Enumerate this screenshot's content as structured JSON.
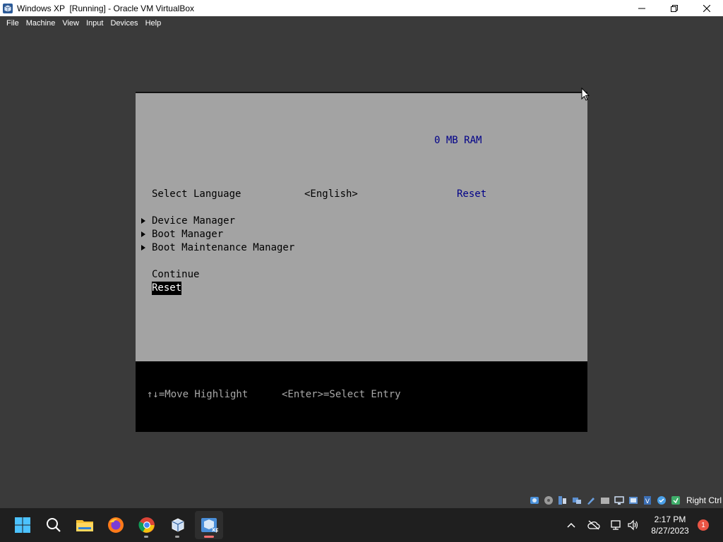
{
  "window": {
    "title": "Windows XP  [Running] - Oracle VM VirtualBox",
    "controls": [
      "minimize",
      "maximize",
      "close"
    ]
  },
  "menubar": {
    "items": [
      "File",
      "Machine",
      "View",
      "Input",
      "Devices",
      "Help"
    ]
  },
  "vm": {
    "ram": "0 MB RAM",
    "language": {
      "label": "Select Language",
      "value": "<English>",
      "reset": "Reset"
    },
    "menu": [
      {
        "label": "Device Manager",
        "submenu": true
      },
      {
        "label": "Boot Manager",
        "submenu": true
      },
      {
        "label": "Boot Maintenance Manager",
        "submenu": true
      }
    ],
    "actions": [
      {
        "label": "Continue",
        "selected": false
      },
      {
        "label": "Reset",
        "selected": true
      }
    ],
    "footer": {
      "help_move": "↑↓=Move Highlight",
      "help_select": "<Enter>=Select Entry"
    }
  },
  "statusbar": {
    "icons": [
      "hard-disk-icon",
      "optical-drive-icon",
      "audio-icon",
      "network-icon",
      "usb-icon",
      "shared-folder-icon",
      "display-icon",
      "video-capture-icon",
      "cpu-icon",
      "guest-additions-icon",
      "mouse-integration-icon"
    ],
    "host_key": "Right Ctrl"
  },
  "taskbar": {
    "apps": [
      "start-icon",
      "search-icon",
      "file-explorer-icon",
      "firefox-icon",
      "chrome-icon",
      "virtualbox-icon",
      "windows-xp-vm-icon"
    ],
    "clock_time": "2:17 PM",
    "clock_date": "8/27/2023",
    "notification_count": "1"
  },
  "colors": {
    "vm_background": "#a3a3a3",
    "vm_blue_text": "#000088",
    "taskbar": "#1f1f1f",
    "app_background": "#3a3a3a"
  }
}
